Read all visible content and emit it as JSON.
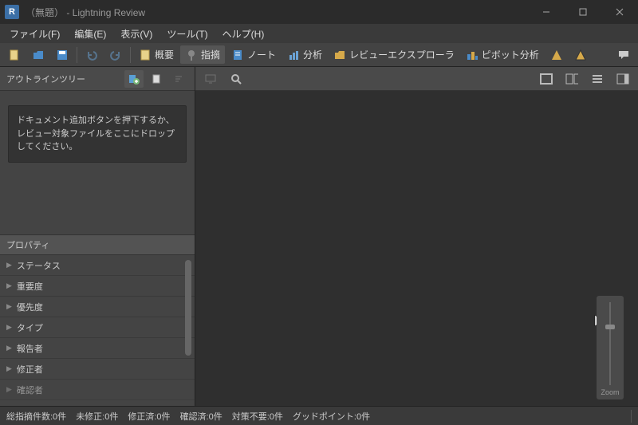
{
  "title": "（無題）   - Lightning Review",
  "app_icon_letter": "R",
  "menu": {
    "file": "ファイル(F)",
    "edit": "編集(E)",
    "view": "表示(V)",
    "tool": "ツール(T)",
    "help": "ヘルプ(H)"
  },
  "toolbar": {
    "overview": "概要",
    "issue": "指摘",
    "note": "ノート",
    "analysis": "分析",
    "review_explorer": "レビューエクスプローラ",
    "pivot": "ピボット分析"
  },
  "sidebar": {
    "outline_title": "アウトラインツリー",
    "drop_hint": "ドキュメント追加ボタンを押下するか、レビュー対象ファイルをここにドロップしてください。",
    "props_title": "プロパティ",
    "props": [
      "ステータス",
      "重要度",
      "優先度",
      "タイプ",
      "報告者",
      "修正者",
      "確認者"
    ]
  },
  "zoom_label": "Zoom",
  "status": {
    "total": "総指摘件数:0件",
    "unfixed": "未修正:0件",
    "fixed": "修正済:0件",
    "confirmed": "確認済:0件",
    "nofix": "対策不要:0件",
    "good": "グッドポイント:0件"
  }
}
